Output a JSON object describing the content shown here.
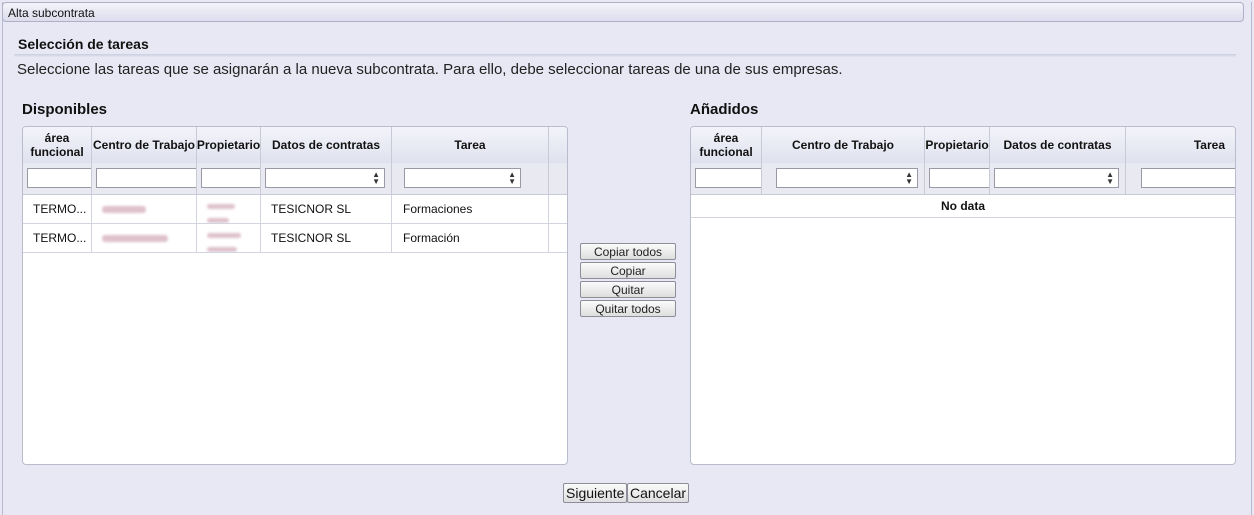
{
  "window": {
    "title": "Alta subcontrata"
  },
  "section": {
    "title": "Selección de tareas",
    "instructions": "Seleccione las tareas que se asignarán a la nueva subcontrata. Para ello, debe seleccionar tareas de una de sus empresas."
  },
  "available": {
    "title": "Disponibles",
    "columns": [
      "área funcional",
      "Centro de Trabajo",
      "Propietario",
      "Datos de contratas",
      "Tarea"
    ],
    "rows": [
      {
        "area": "TERMO...",
        "centro": "",
        "propietario": "",
        "datos": "TESICNOR SL",
        "tarea": "Formaciones"
      },
      {
        "area": "TERMO...",
        "centro": "",
        "propietario": "",
        "datos": "TESICNOR SL",
        "tarea": "Formación"
      }
    ]
  },
  "added": {
    "title": "Añadidos",
    "columns": [
      "área funcional",
      "Centro de Trabajo",
      "Propietario",
      "Datos de contratas",
      "Tarea"
    ],
    "empty_text": "No data"
  },
  "transfer_buttons": {
    "copy_all": "Copiar todos",
    "copy": "Copiar",
    "remove": "Quitar",
    "remove_all": "Quitar todos"
  },
  "footer": {
    "next": "Siguiente",
    "cancel": "Cancelar"
  },
  "icons": {
    "sort_arrows": "sort-updown-icon"
  },
  "colors": {
    "background": "#e8e8f4",
    "header": "#dfe1ee",
    "blurred_text": "#d9b7c2"
  }
}
